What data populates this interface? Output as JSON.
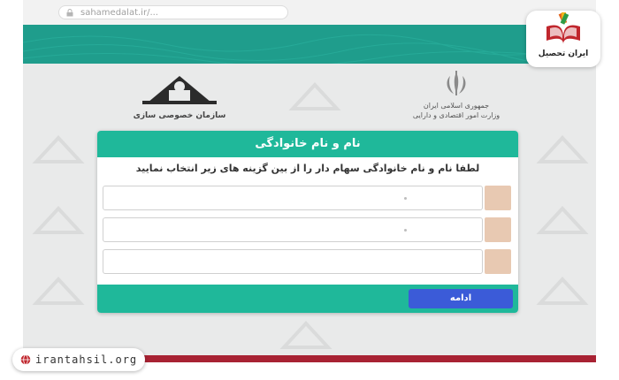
{
  "browser": {
    "url": "sahamedalat.ir/..."
  },
  "header": {
    "right_org_line1": "جمهوری اسلامی ایران",
    "right_org_line2": "وزارت امور اقتصادی و دارایی",
    "left_org_name": "سازمان خصوصی سازی"
  },
  "dialog": {
    "title": "نام و نام خانوادگی",
    "instruction": "لطفا نام و نام خانوادگی سهام دار را از بین گزینه های زیر انتخاب نمایید",
    "options": [
      {
        "value": ""
      },
      {
        "value": ""
      },
      {
        "value": ""
      }
    ],
    "continue_label": "ادامه"
  },
  "branding": {
    "badge_name": "ایران تحصیل",
    "website": "irantahsil.org"
  },
  "colors": {
    "teal": "#1fb89a",
    "band": "#1f9d8c",
    "button": "#3b5bd8",
    "radio": "#e8c9b2",
    "accent_red": "#a82233"
  }
}
